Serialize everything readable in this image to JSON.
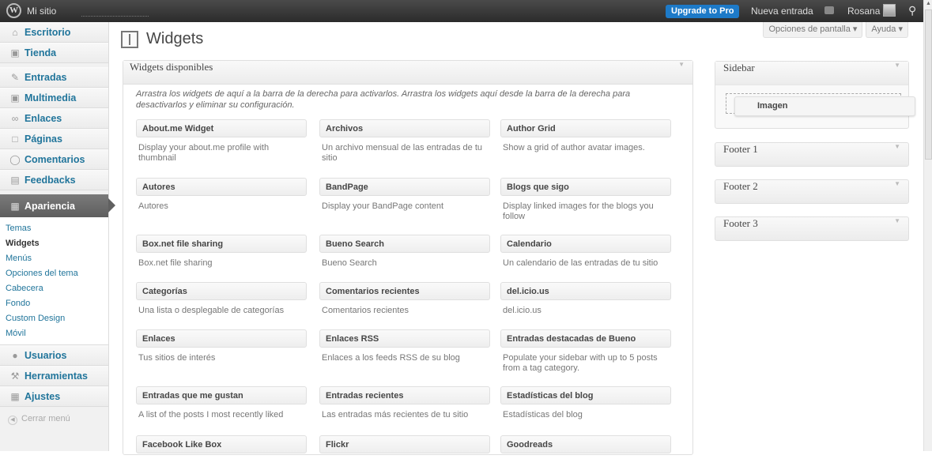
{
  "adminbar": {
    "site_name": "Mi sitio",
    "upgrade": "Upgrade to Pro",
    "new_post": "Nueva entrada",
    "user": "Rosana"
  },
  "screen_options": {
    "screen": "Opciones de pantalla",
    "help": "Ayuda"
  },
  "page": {
    "title": "Widgets"
  },
  "menu": {
    "escritorio": "Escritorio",
    "tienda": "Tienda",
    "entradas": "Entradas",
    "multimedia": "Multimedia",
    "enlaces": "Enlaces",
    "paginas": "Páginas",
    "comentarios": "Comentarios",
    "feedbacks": "Feedbacks",
    "apariencia": "Apariencia",
    "submenu": [
      "Temas",
      "Widgets",
      "Menús",
      "Opciones del tema",
      "Cabecera",
      "Fondo",
      "Custom Design",
      "Móvil"
    ],
    "usuarios": "Usuarios",
    "herramientas": "Herramientas",
    "ajustes": "Ajustes",
    "collapse": "Cerrar menú"
  },
  "available": {
    "title": "Widgets disponibles",
    "description": "Arrastra los widgets de aquí a la barra de la derecha para activarlos. Arrastra los widgets aquí desde la barra de la derecha para desactivarlos y eliminar su configuración.",
    "widgets": [
      {
        "title": "About.me Widget",
        "desc": "Display your about.me profile with thumbnail"
      },
      {
        "title": "Archivos",
        "desc": "Un archivo mensual de las entradas de tu sitio"
      },
      {
        "title": "Author Grid",
        "desc": "Show a grid of author avatar images."
      },
      {
        "title": "Autores",
        "desc": "Autores"
      },
      {
        "title": "BandPage",
        "desc": "Display your BandPage content"
      },
      {
        "title": "Blogs que sigo",
        "desc": "Display linked images for the blogs you follow"
      },
      {
        "title": "Box.net file sharing",
        "desc": "Box.net file sharing"
      },
      {
        "title": "Bueno Search",
        "desc": "Bueno Search"
      },
      {
        "title": "Calendario",
        "desc": "Un calendario de las entradas de tu sitio"
      },
      {
        "title": "Categorías",
        "desc": "Una lista o desplegable de categorías"
      },
      {
        "title": "Comentarios recientes",
        "desc": "Comentarios recientes"
      },
      {
        "title": "del.icio.us",
        "desc": "del.icio.us"
      },
      {
        "title": "Enlaces",
        "desc": "Tus sitios de interés"
      },
      {
        "title": "Enlaces RSS",
        "desc": "Enlaces a los feeds RSS de su blog"
      },
      {
        "title": "Entradas destacadas de Bueno",
        "desc": "Populate your sidebar with up to 5 posts from a tag category."
      },
      {
        "title": "Entradas que me gustan",
        "desc": "A list of the posts I most recently liked"
      },
      {
        "title": "Entradas recientes",
        "desc": "Las entradas más recientes de tu sitio"
      },
      {
        "title": "Estadísticas del blog",
        "desc": "Estadísticas del blog"
      },
      {
        "title": "Facebook Like Box",
        "desc": ""
      },
      {
        "title": "Flickr",
        "desc": ""
      },
      {
        "title": "Goodreads",
        "desc": ""
      }
    ]
  },
  "sidebars": {
    "sidebar": "Sidebar",
    "footer1": "Footer 1",
    "footer2": "Footer 2",
    "footer3": "Footer 3",
    "dragging": "Imagen"
  }
}
